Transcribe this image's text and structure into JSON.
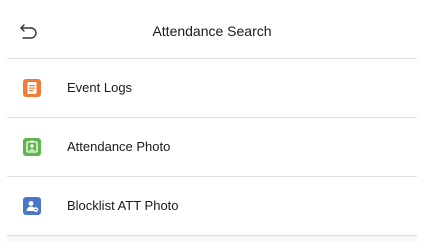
{
  "header": {
    "back_icon": "back-arrow-icon",
    "title": "Attendance Search"
  },
  "menu": {
    "items": [
      {
        "label": "Event Logs",
        "icon": "document-icon",
        "color": "#f07c35"
      },
      {
        "label": "Attendance Photo",
        "icon": "photo-id-icon",
        "color": "#5cb84a"
      },
      {
        "label": "Blocklist ATT Photo",
        "icon": "blocked-user-icon",
        "color": "#4a78c8"
      }
    ]
  }
}
